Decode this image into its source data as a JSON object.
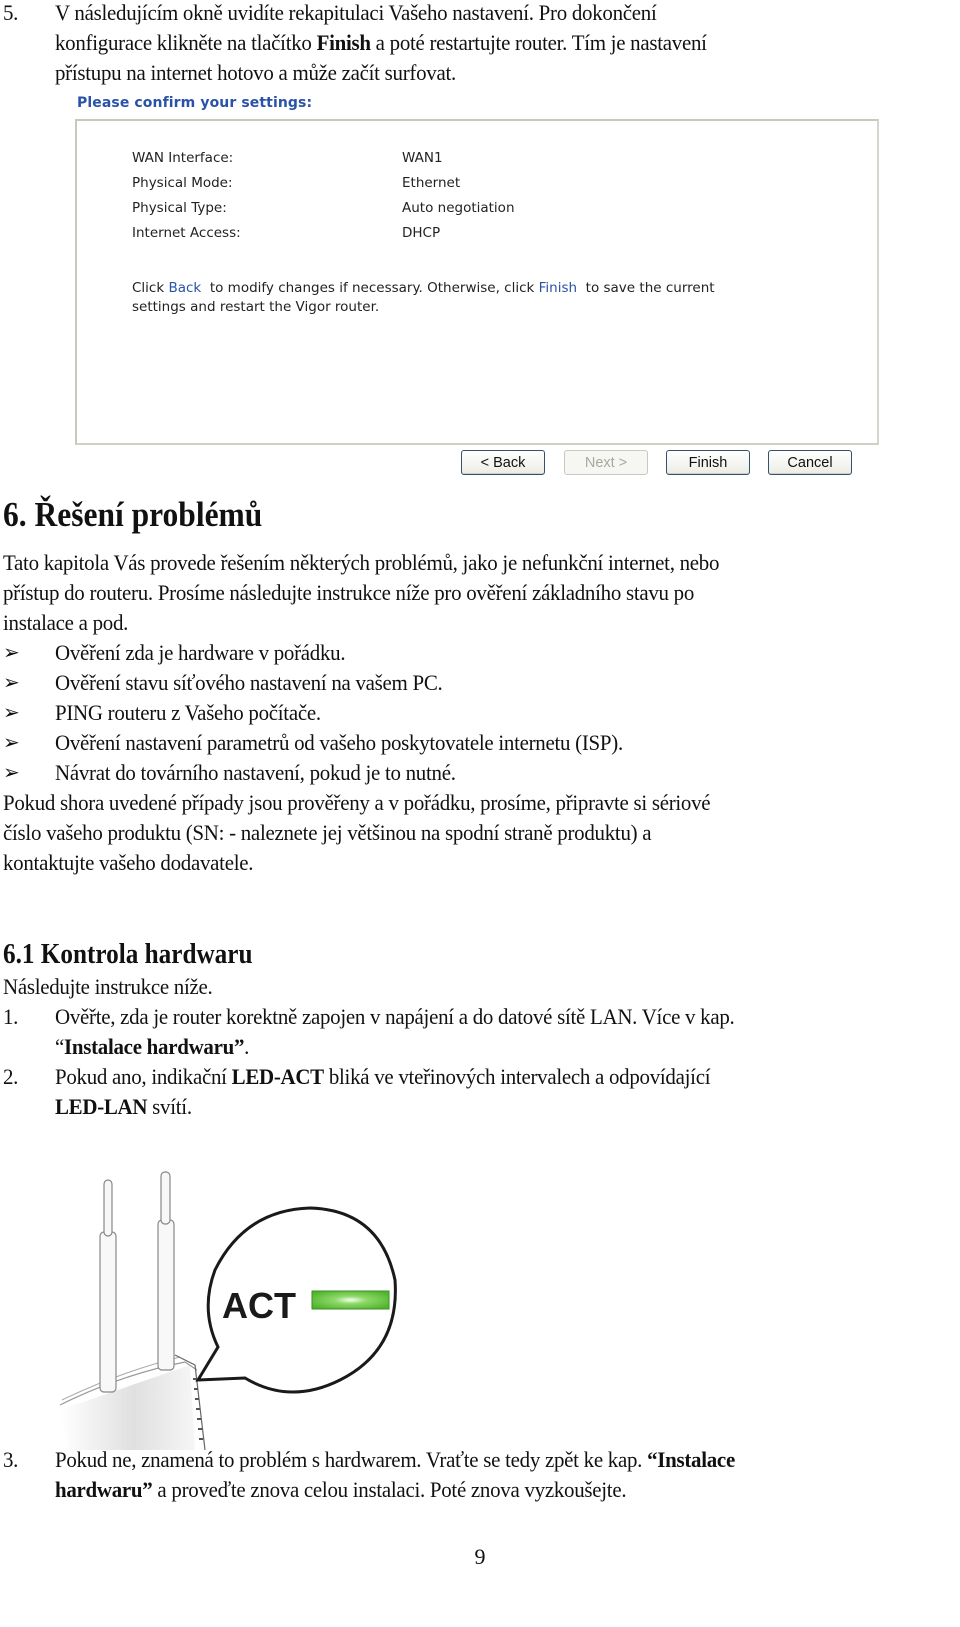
{
  "step5": {
    "number": "5.",
    "lines": [
      "V následujícím okně uvidíte rekapitulaci Vašeho nastavení. Pro dokončení",
      "přístupu na internet hotovo a může začít surfovat."
    ],
    "line2_pre": "konfigurace klikněte na tlačítko ",
    "line2_bold": "Finish",
    "line2_post": " a poté restartujte router. Tím je nastavení"
  },
  "wizard": {
    "title": "Please confirm your settings:",
    "settings": [
      {
        "label": "WAN Interface:",
        "value": "WAN1"
      },
      {
        "label": "Physical Mode:",
        "value": "Ethernet"
      },
      {
        "label": "Physical Type:",
        "value": "Auto negotiation"
      },
      {
        "label": "Internet Access:",
        "value": "DHCP"
      }
    ],
    "note": {
      "pre": "Click ",
      "back": "Back",
      "mid": "  to modify changes if necessary. Otherwise, click ",
      "finish": "Finish",
      "post": "  to save the current",
      "line2": "settings and restart the Vigor router."
    },
    "buttons": {
      "back": "< Back",
      "next": "Next >",
      "finish": "Finish",
      "cancel": "Cancel"
    },
    "link_color": "#2a52a8"
  },
  "section6": {
    "heading": "6. Řešení problémů",
    "intro": [
      "Tato kapitola Vás provede řešením některých problémů, jako je nefunkční internet, nebo",
      "přístup do routeru. Prosíme následujte instrukce níže pro ověření základního stavu po",
      "instalace a pod."
    ],
    "bullets": [
      "Ověření zda je hardware v pořádku.",
      "Ověření stavu síťového nastavení na vašem PC.",
      "PING routeru z Vašeho počítače.",
      "Ověření nastavení parametrů od vašeho poskytovatele internetu (ISP).",
      "Návrat do továrního nastavení, pokud je to nutné."
    ],
    "bullet_icon": "➢",
    "outro": [
      "Pokud shora uvedené případy jsou prověřeny a v pořádku, prosíme, připravte si sériové",
      "číslo vašeho produktu (SN: - naleznete jej většinou na spodní straně produktu) a",
      "kontaktujte vašeho dodavatele."
    ]
  },
  "section61": {
    "heading": "6.1 Kontrola hardwaru",
    "intro": "Následujte instrukce níže.",
    "items": [
      {
        "number": "1.",
        "line1": "Ověřte, zda je router korektně zapojen v napájení a do datové sítě LAN. Více v kap.",
        "line2_quote_open": "“",
        "line2_bold": "Instalace hardwaru",
        "line2_quote_close": "”",
        "line2_post": "."
      },
      {
        "number": "2.",
        "pre": "Pokud ano, indikační ",
        "bold1": "LED-ACT",
        "mid": " bliká ve vteřinových intervalech a odpovídající",
        "bold2": "LED-LAN",
        "post": " svítí."
      },
      {
        "number": "3.",
        "pre": "Pokud ne, znamená to problém s hardwarem. Vraťte se tedy zpět ke kap. ",
        "bold_a": "“Instalace",
        "bold_b": "hardwaru”",
        "post": " a proveďte znova celou instalaci. Poté znova vyzkoušejte."
      }
    ],
    "figure": {
      "led_label": "ACT",
      "led_color": "#5cc13a"
    }
  },
  "page_number": "9"
}
